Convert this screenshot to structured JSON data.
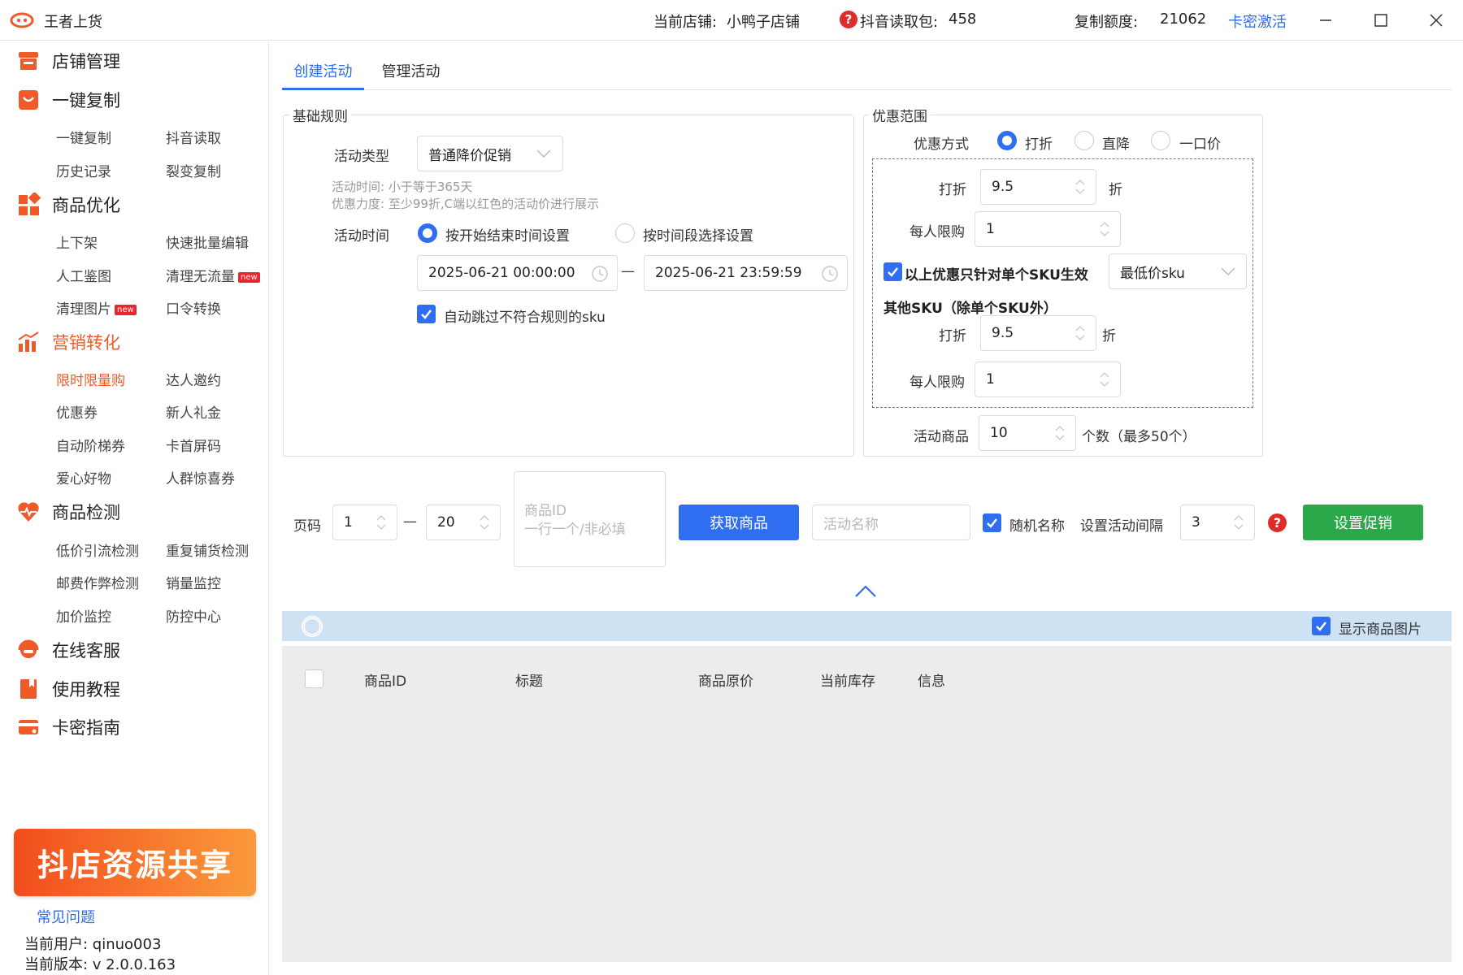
{
  "app": {
    "title": "王者上货"
  },
  "header": {
    "shop_label": "当前店铺:",
    "shop_name": "小鸭子店铺",
    "douyin_label": "抖音读取包:",
    "douyin_value": "458",
    "quota_label": "复制额度:",
    "quota_value": "21062",
    "activate_link": "卡密激活"
  },
  "sidebar": {
    "sections": [
      {
        "label": "店铺管理",
        "icon": "store-icon"
      },
      {
        "label": "一键复制",
        "icon": "bag-icon"
      },
      {
        "label": "商品优化",
        "icon": "grid-icon"
      },
      {
        "label": "营销转化",
        "icon": "chart-icon"
      },
      {
        "label": "商品检测",
        "icon": "heartbeat-icon"
      },
      {
        "label": "在线客服",
        "icon": "headset-icon"
      },
      {
        "label": "使用教程",
        "icon": "book-icon"
      },
      {
        "label": "卡密指南",
        "icon": "card-icon"
      }
    ],
    "copy_items": [
      "一键复制",
      "抖音读取",
      "历史记录",
      "裂变复制"
    ],
    "optimize_items": [
      "上下架",
      "快速批量编辑",
      "人工鉴图",
      "清理无流量",
      "清理图片",
      "口令转换"
    ],
    "new_badge": "new",
    "marketing_items": [
      "限时限量购",
      "达人邀约",
      "优惠券",
      "新人礼金",
      "自动阶梯券",
      "卡首屏码",
      "爱心好物",
      "人群惊喜券"
    ],
    "detect_items": [
      "低价引流检测",
      "重复铺货检测",
      "邮费作弊检测",
      "销量监控",
      "加价监控",
      "防控中心"
    ],
    "banner_text": "抖店资源共享",
    "faq_link": "常见问题",
    "user_line": "当前用户: qinuo003",
    "version_line": "当前版本: v 2.0.0.163"
  },
  "tabs": [
    {
      "label": "创建活动",
      "active": true
    },
    {
      "label": "管理活动",
      "active": false
    }
  ],
  "basic_rules": {
    "legend": "基础规则",
    "type_label": "活动类型",
    "type_value": "普通降价促销",
    "hint1": "活动时间: 小于等于365天",
    "hint2": "优惠力度: 至少99折,C端以红色的活动价进行展示",
    "time_label": "活动时间",
    "time_option1": "按开始结束时间设置",
    "time_option2": "按时间段选择设置",
    "start_time": "2025-06-21 00:00:00",
    "end_time": "2025-06-21 23:59:59",
    "dash": "—",
    "skip_sku_label": "自动跳过不符合规则的sku"
  },
  "discount_scope": {
    "legend": "优惠范围",
    "mode_label": "优惠方式",
    "mode_options": [
      "打折",
      "直降",
      "一口价"
    ],
    "discount_label": "打折",
    "discount_value": "9.5",
    "discount_unit": "折",
    "limit_label": "每人限购",
    "limit_value": "1",
    "single_sku_label": "以上优惠只针对单个SKU生效",
    "sku_select": "最低价sku",
    "other_sku_title": "其他SKU（除单个SKU外）",
    "other_discount_label": "打折",
    "other_discount_value": "9.5",
    "other_discount_unit": "折",
    "other_limit_label": "每人限购",
    "other_limit_value": "1",
    "goods_label": "活动商品",
    "goods_value": "10",
    "goods_hint": "个数（最多50个）"
  },
  "controls": {
    "page_label": "页码",
    "page_from": "1",
    "page_to": "20",
    "dash": "—",
    "product_id_placeholder_line1": "商品ID",
    "product_id_placeholder_line2": "一行一个/非必填",
    "fetch_button": "获取商品",
    "name_placeholder": "活动名称",
    "random_name_label": "随机名称",
    "interval_label": "设置活动间隔",
    "interval_value": "3",
    "set_promo_button": "设置促销"
  },
  "table": {
    "show_image_label": "显示商品图片",
    "columns": [
      "商品ID",
      "标题",
      "商品原价",
      "当前库存",
      "信息"
    ],
    "rows": []
  },
  "colors": {
    "accent_blue": "#2f6ef0",
    "orange": "#f05a28",
    "green": "#2ba84a",
    "info_bar": "#cfe2f3",
    "table_bg": "#ececec"
  }
}
